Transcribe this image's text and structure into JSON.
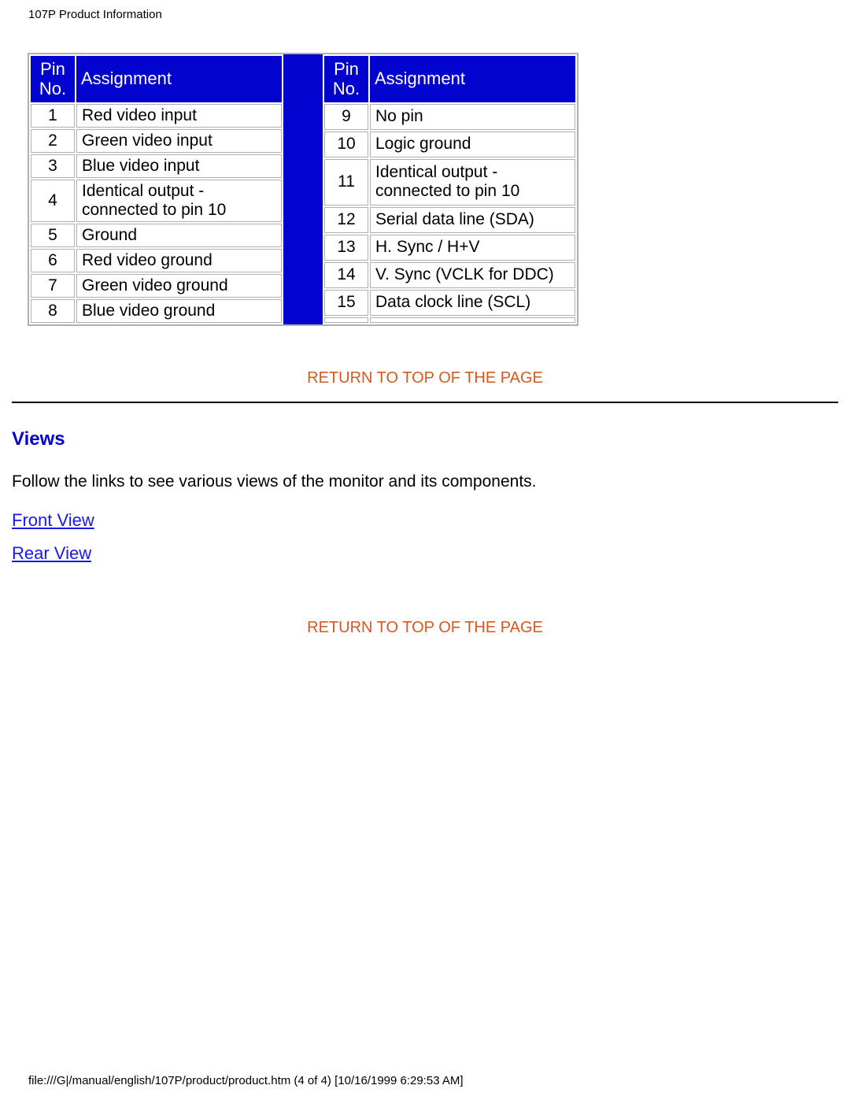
{
  "header": {
    "title": "107P Product Information"
  },
  "pin_table": {
    "headers": {
      "pin_no": "Pin No.",
      "assignment": "Assignment"
    },
    "left_rows": [
      {
        "no": "1",
        "assignment": "Red video input"
      },
      {
        "no": "2",
        "assignment": "Green video input"
      },
      {
        "no": "3",
        "assignment": "Blue video input"
      },
      {
        "no": "4",
        "assignment": "Identical output - connected to pin 10"
      },
      {
        "no": "5",
        "assignment": "Ground"
      },
      {
        "no": "6",
        "assignment": "Red video ground"
      },
      {
        "no": "7",
        "assignment": "Green video ground"
      },
      {
        "no": "8",
        "assignment": "Blue video ground"
      }
    ],
    "right_rows": [
      {
        "no": "9",
        "assignment": "No pin"
      },
      {
        "no": "10",
        "assignment": "Logic ground"
      },
      {
        "no": "11",
        "assignment": "Identical output - connected to pin 10"
      },
      {
        "no": "12",
        "assignment": "Serial data line (SDA)"
      },
      {
        "no": "13",
        "assignment": "H. Sync / H+V"
      },
      {
        "no": "14",
        "assignment": "V. Sync (VCLK for DDC)"
      },
      {
        "no": "15",
        "assignment": "Data clock line (SCL)"
      },
      {
        "no": "",
        "assignment": ""
      }
    ]
  },
  "return_link": "RETURN TO TOP OF THE PAGE",
  "views": {
    "title": "Views",
    "text": "Follow the links to see various views of the monitor and its components.",
    "links": {
      "front": "Front View",
      "rear": "Rear View"
    }
  },
  "footer": "file:///G|/manual/english/107P/product/product.htm (4 of 4) [10/16/1999 6:29:53 AM]"
}
